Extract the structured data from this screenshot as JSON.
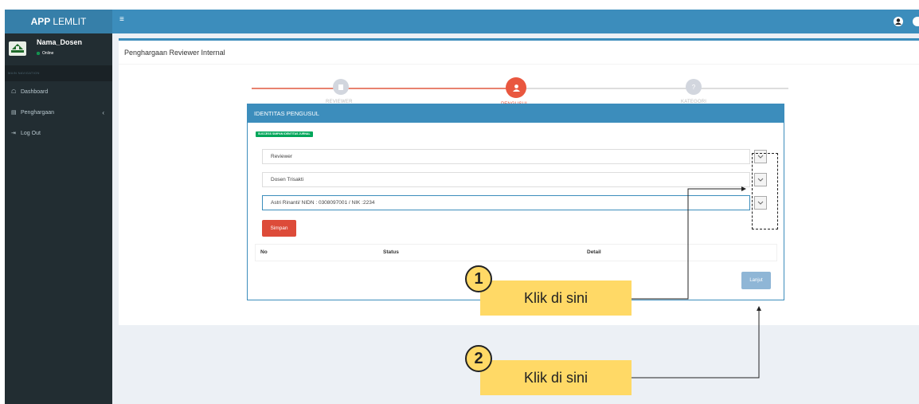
{
  "app": {
    "title_bold": "APP",
    "title_rest": "LEMLIT"
  },
  "user": {
    "name": "Nama_Dosen",
    "status": "Online"
  },
  "sidebar": {
    "header": "MAIN NAVIGATION",
    "items": [
      {
        "label": "Dashboard",
        "icon": "home-icon"
      },
      {
        "label": "Penghargaan",
        "icon": "book-icon"
      },
      {
        "label": "Log Out",
        "icon": "logout-icon"
      }
    ]
  },
  "page": {
    "title": "Penghargaan Reviewer Internal"
  },
  "stepper": {
    "steps": [
      {
        "label": "REVIEWER",
        "state": "done"
      },
      {
        "label": "PENGUSUL",
        "state": "active"
      },
      {
        "label": "KATEGORI",
        "state": "pending"
      }
    ]
  },
  "panel": {
    "title": "IDENTITAS PENGUSUL",
    "badge": "SUCCESS SIMPAN IDENTITAS JURNAL",
    "fields": [
      {
        "value": "Reviewer"
      },
      {
        "value": "Dosen Trisakti"
      },
      {
        "value": "Astri Rinanti/ NIDN : 0308097001 / NIK :2234"
      }
    ],
    "save_label": "Simpan",
    "table_headers": [
      "No",
      "Status",
      "Detail"
    ],
    "next_label": "Lanjut"
  },
  "annotations": [
    {
      "number": "1",
      "text": "Klik di sini"
    },
    {
      "number": "2",
      "text": "Klik di sini"
    }
  ],
  "colors": {
    "primary": "#3c8dbc",
    "sidebar": "#222d32",
    "danger": "#dd4b39",
    "success": "#00a65a",
    "callout": "#ffd966"
  }
}
